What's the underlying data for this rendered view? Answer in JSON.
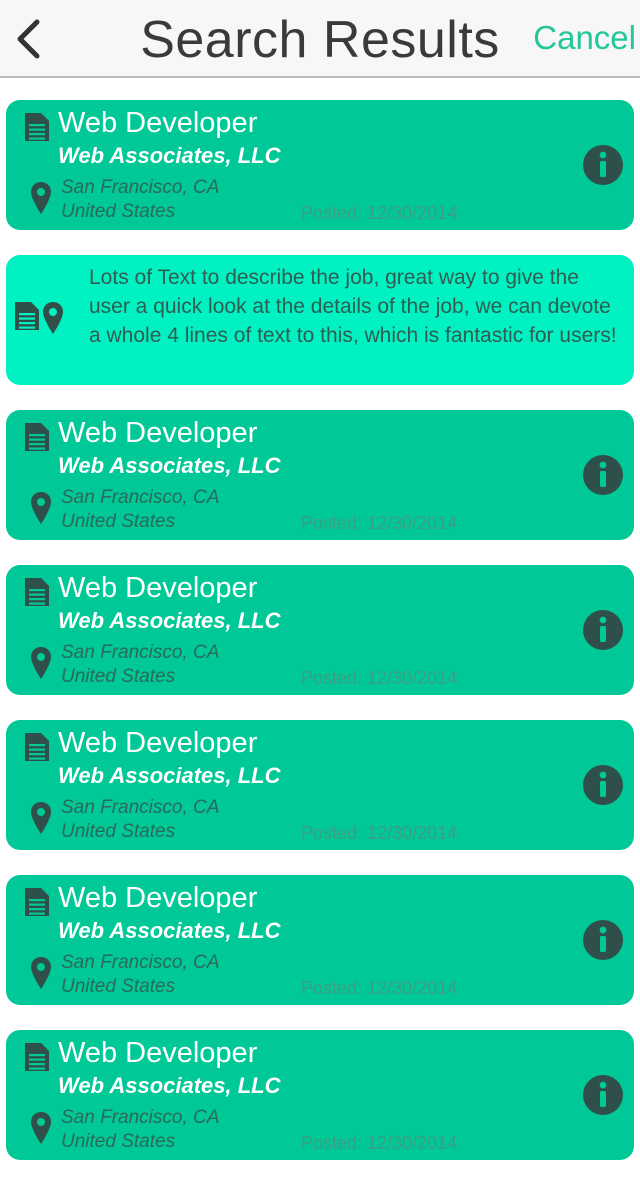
{
  "navbar": {
    "title": "Search Results",
    "cancel_label": "Cancel",
    "accent_color": "#25c79a"
  },
  "colors": {
    "card": "#00c897",
    "card_expanded": "#00f2c2",
    "icon": "#2f4f4a"
  },
  "jobs": [
    {
      "title": "Web Developer",
      "company": "Web Associates, LLC",
      "city": "San Francisco, CA",
      "country": "United States",
      "posted": "Posted: 12/30/2014"
    },
    {
      "description": "Lots of Text to describe the job, great way to give the user a quick look at the details of the job, we can devote a whole 4 lines of text to this, which is fantastic for users!"
    },
    {
      "title": "Web Developer",
      "company": "Web Associates, LLC",
      "city": "San Francisco, CA",
      "country": "United States",
      "posted": "Posted: 12/30/2014"
    },
    {
      "title": "Web Developer",
      "company": "Web Associates, LLC",
      "city": "San Francisco, CA",
      "country": "United States",
      "posted": "Posted: 12/30/2014"
    },
    {
      "title": "Web Developer",
      "company": "Web Associates, LLC",
      "city": "San Francisco, CA",
      "country": "United States",
      "posted": "Posted: 12/30/2014"
    },
    {
      "title": "Web Developer",
      "company": "Web Associates, LLC",
      "city": "San Francisco, CA",
      "country": "United States",
      "posted": "Posted: 12/30/2014"
    },
    {
      "title": "Web Developer",
      "company": "Web Associates, LLC",
      "city": "San Francisco, CA",
      "country": "United States",
      "posted": "Posted: 12/30/2014"
    }
  ]
}
